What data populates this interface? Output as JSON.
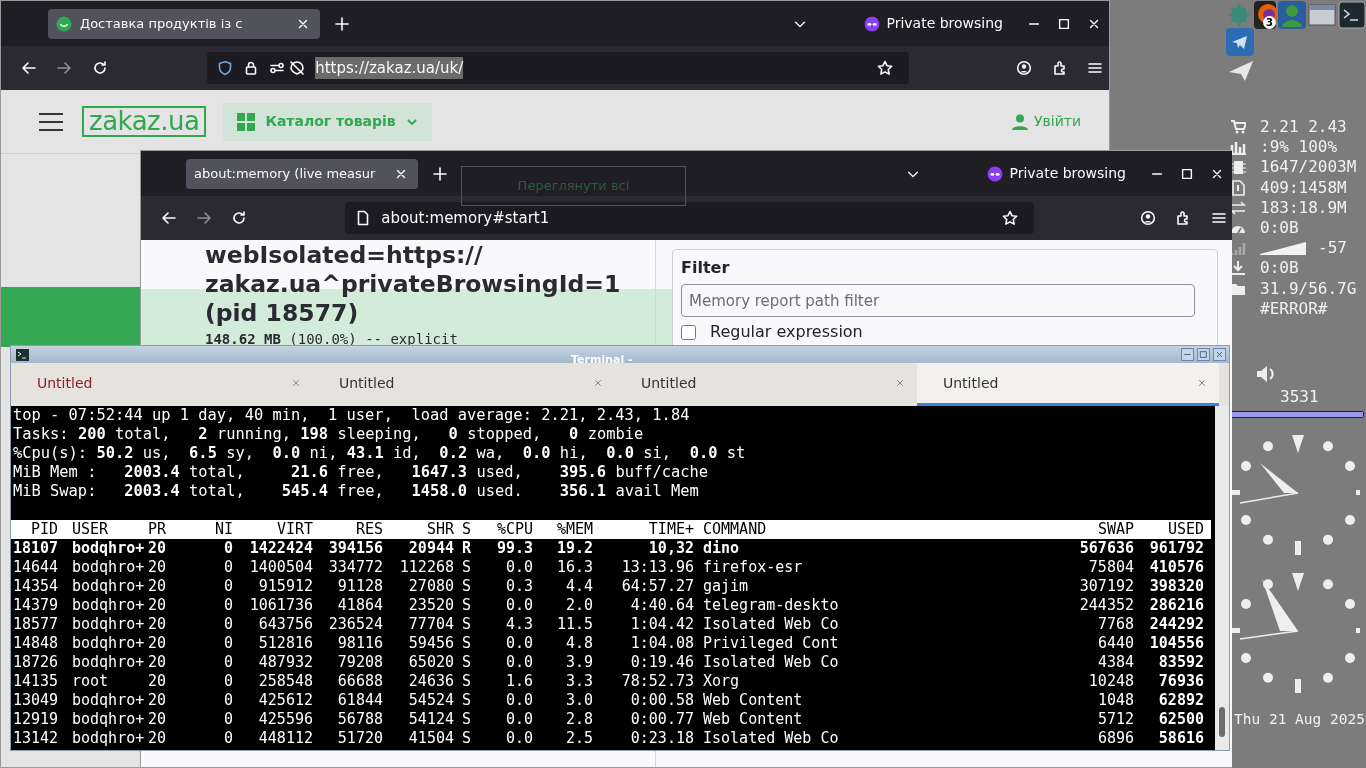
{
  "browser_back": {
    "tab": {
      "title": "Доставка продуктів із с",
      "selected": true
    },
    "private_label": "Private browsing",
    "url": "https://zakaz.ua/uk/",
    "url_selected": true,
    "page": {
      "logo": "zakaz.ua",
      "catalog": "Каталог товарів",
      "login": "Увійти",
      "see_all": "Переглянути всі"
    }
  },
  "browser_front": {
    "tab": {
      "title": "about:memory (live measur",
      "selected": true
    },
    "private_label": "Private browsing",
    "url": "about:memory#start1",
    "url_selected": false,
    "page": {
      "heading": "webIsolated=https:// zakaz.ua^privateBrowsingId=1 (pid 18577)",
      "explicit": "**148.62 MB** (100.0%) -- explicit",
      "filter_title": "Filter",
      "filter": {
        "placeholder": "Memory report path filter"
      },
      "regex": {
        "label": "Regular expression",
        "checked": false
      }
    }
  },
  "terminal": {
    "title": "Terminal -",
    "tabs": [
      {
        "label": "Untitled",
        "selected": false,
        "attention": true
      },
      {
        "label": "Untitled",
        "selected": false,
        "attention": false
      },
      {
        "label": "Untitled",
        "selected": false,
        "attention": false
      },
      {
        "label": "Untitled",
        "selected": true,
        "attention": false
      }
    ],
    "summary": [
      "top - 07:52:44 up 1 day, 40 min,  1 user,  load average: 2.21, 2.43, 1.84",
      "Tasks: **200** total,   **2** running, **198** sleeping,   **0** stopped,   **0** zombie",
      "%Cpu(s): **50.2** us,  **6.5** sy,  **0.0** ni, **43.1** id,  **0.2** wa,  **0.0** hi,  **0.0** si,  **0.0** st",
      "MiB Mem :   **2003.4** total,     **21.6** free,   **1647.3** used,    **395.6** buff/cache",
      "MiB Swap:   **2003.4** total,    **545.4** free,   **1458.0** used.    **356.1** avail Mem"
    ],
    "columns": [
      "PID",
      "USER",
      "PR",
      "NI",
      "VIRT",
      "RES",
      "SHR",
      "S",
      "%CPU",
      "%MEM",
      "TIME+",
      "COMMAND",
      "SWAP",
      "USED"
    ],
    "rows": [
      {
        "highlighted": true,
        "cells": [
          "18107",
          "bodqhro+",
          "20",
          "0",
          "1422424",
          "394156",
          "20944",
          "R",
          "99.3",
          "19.2",
          "10,32",
          "dino",
          "567636",
          "961792"
        ]
      },
      {
        "highlighted": false,
        "cells": [
          "14644",
          "bodqhro+",
          "20",
          "0",
          "1400504",
          "334772",
          "112268",
          "S",
          "0.0",
          "16.3",
          "13:13.96",
          "firefox-esr",
          "75804",
          "410576"
        ]
      },
      {
        "highlighted": false,
        "cells": [
          "14354",
          "bodqhro+",
          "20",
          "0",
          "915912",
          "91128",
          "27080",
          "S",
          "0.3",
          "4.4",
          "64:57.27",
          "gajim",
          "307192",
          "398320"
        ]
      },
      {
        "highlighted": false,
        "cells": [
          "14379",
          "bodqhro+",
          "20",
          "0",
          "1061736",
          "41864",
          "23520",
          "S",
          "0.0",
          "2.0",
          "4:40.64",
          "telegram-deskto",
          "244352",
          "286216"
        ]
      },
      {
        "highlighted": false,
        "cells": [
          "18577",
          "bodqhro+",
          "20",
          "0",
          "643756",
          "236524",
          "77704",
          "S",
          "4.3",
          "11.5",
          "1:04.42",
          "Isolated Web Co",
          "7768",
          "244292"
        ]
      },
      {
        "highlighted": false,
        "cells": [
          "14848",
          "bodqhro+",
          "20",
          "0",
          "512816",
          "98116",
          "59456",
          "S",
          "0.0",
          "4.8",
          "1:04.08",
          "Privileged Cont",
          "6440",
          "104556"
        ]
      },
      {
        "highlighted": false,
        "cells": [
          "18726",
          "bodqhro+",
          "20",
          "0",
          "487932",
          "79208",
          "65020",
          "S",
          "0.0",
          "3.9",
          "0:19.46",
          "Isolated Web Co",
          "4384",
          "83592"
        ]
      },
      {
        "highlighted": false,
        "cells": [
          "14135",
          "root",
          "20",
          "0",
          "258548",
          "66688",
          "24636",
          "S",
          "1.6",
          "3.3",
          "78:52.73",
          "Xorg",
          "10248",
          "76936"
        ]
      },
      {
        "highlighted": false,
        "cells": [
          "13049",
          "bodqhro+",
          "20",
          "0",
          "425612",
          "61844",
          "54524",
          "S",
          "0.0",
          "3.0",
          "0:00.58",
          "Web Content",
          "1048",
          "62892"
        ]
      },
      {
        "highlighted": false,
        "cells": [
          "12919",
          "bodqhro+",
          "20",
          "0",
          "425596",
          "56788",
          "54124",
          "S",
          "0.0",
          "2.8",
          "0:00.77",
          "Web Content",
          "5712",
          "62500"
        ]
      },
      {
        "highlighted": false,
        "cells": [
          "13142",
          "bodqhro+",
          "20",
          "0",
          "448112",
          "51720",
          "41504",
          "S",
          "0.0",
          "2.5",
          "0:23.18",
          "Isolated Web Co",
          "6896",
          "58616"
        ]
      }
    ]
  },
  "panel": {
    "firefox_badge": "3",
    "stats": [
      {
        "kind": "stat",
        "text": "2.21 2.43"
      },
      {
        "kind": "stat",
        "text": ":9% 100%"
      },
      {
        "kind": "stat",
        "text": "1647/2003M"
      },
      {
        "kind": "stat",
        "text": "409:1458M"
      },
      {
        "kind": "stat",
        "text": "183:18.9M"
      },
      {
        "kind": "stat",
        "text": "0:0B"
      },
      {
        "kind": "signal",
        "text": "-57"
      },
      {
        "kind": "stat",
        "text": "0:0B"
      },
      {
        "kind": "stat",
        "text": "31.9/56.7G"
      },
      {
        "kind": "stat",
        "text": "#ERROR#"
      }
    ],
    "volume": {
      "reading": "3531",
      "level": 1
    },
    "date": "Thu 21 Aug 2025"
  }
}
